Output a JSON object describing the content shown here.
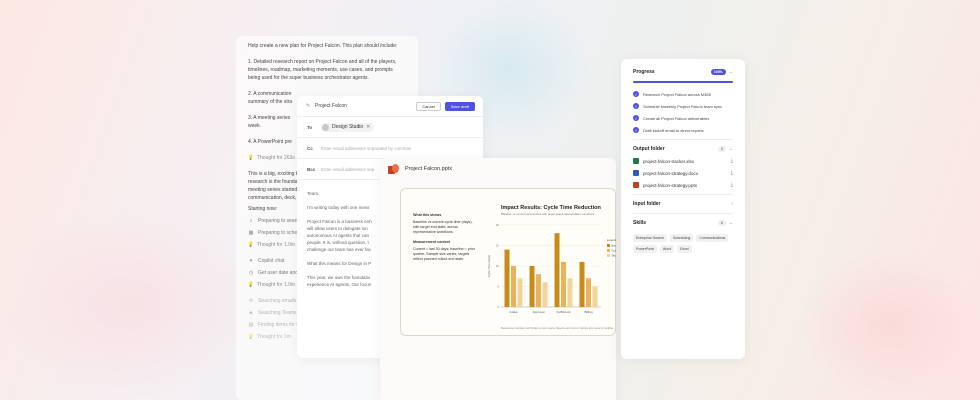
{
  "chat": {
    "prompt_intro": "Help create a new plan for Project Falcon. This plan should include:",
    "item1": "1. Detailed research report on Project Falcon and all of the players, timelines, roadmap, marketing moments, use cases, and prompts being used for the super business orchestrator agents.",
    "item2": "2. A communication",
    "item2b": "summary of the stra",
    "item3": "3. A meeting series",
    "item3b": "week.",
    "item4": "4. A PowerPoint pre",
    "thought1": "Thought for 263s",
    "body1": "This is a big, exciting kic",
    "body2": "research is the foundatio",
    "body3": "meeting series started. C",
    "body4": "communication, deck, st",
    "starting": "Starting now:",
    "step1": "Preparing to search acro",
    "step2": "Preparing to schedule w",
    "thought2": "Thought for 1.0m",
    "copilot": "Copilot chat",
    "step3": "Get user date and time",
    "thought3": "Thought for 1.0m",
    "step4": "Searching emails for \"Pr",
    "step5": "Searching Teams for \"Pr",
    "step6": "Finding items for Pr",
    "thought4": "Thought for 1m"
  },
  "email": {
    "title": "Project Falcon",
    "cancel": "Cancel",
    "send": "Save draft",
    "to_label": "To",
    "to_chip": "Design Studio",
    "cc_label": "Cc",
    "cc_placeholder": "Enter email addresses separated by commas",
    "bcc_label": "Bcc",
    "bcc_placeholder": "Enter email addresses sep",
    "greeting": "Team,",
    "p1": "I'm writing today with one mess",
    "p2a": "Project Falcon is a business enh",
    "p2b": "will allow users to delegate lon",
    "p2c": "autonomous AI agents that can",
    "p2d": "people. It is, without question, t",
    "p2e": "challenge our team has ever fac",
    "p3": "What this means for Design in P",
    "p4a": "This year, we own the foundatio",
    "p4b": "experience AI agents. Our focus"
  },
  "viewer": {
    "filename": "Project Falcon.pptx"
  },
  "slide": {
    "what_heading": "What this shows",
    "what_text": "Baseline vs current cycle time (days), with target end state, across representative workflows.",
    "measure_heading": "Measurement context",
    "measure_text": "Current = last 30 days; baseline = prior quarter. Sample size varies; targets reflect planned rollout end state.",
    "footnote": "Measurement window: last 30 days vs prior quarter. Baseline and Current. Sample size varies by workflow."
  },
  "chart_data": {
    "type": "bar",
    "title": "Impact Results: Cycle Time Reduction",
    "subtitle": "Baseline vs current performance with target post-implementation conditions",
    "ylabel": "Cycle Time (days)",
    "xlabel": "",
    "categories": [
      "Intake",
      "Approval",
      "Fulfillment",
      "Billing"
    ],
    "series": [
      {
        "name": "Baseline",
        "values": [
          14,
          10,
          18,
          11
        ]
      },
      {
        "name": "Current",
        "values": [
          10,
          8,
          11,
          7
        ]
      },
      {
        "name": "Target",
        "values": [
          7,
          6,
          7,
          5
        ]
      }
    ],
    "legend_title": "Legend",
    "legend_position": "right",
    "colors": [
      "#c98a18",
      "#e8b35a",
      "#f3d49a"
    ],
    "ylim": [
      0,
      20
    ],
    "yticks": [
      0,
      5,
      10,
      15,
      20
    ],
    "grid": true
  },
  "progress": {
    "title": "Progress",
    "percent": "100%",
    "fraction": 1.0,
    "tasks": [
      "Research Project Falcon across M365",
      "Schedule biweekly Project Falcon team sync",
      "Create all Project Falcon deliverables",
      "Draft kickoff email to direct reports"
    ],
    "output_title": "Output folder",
    "output_count": "3",
    "files": [
      {
        "name": "project-falcon-tracker.xlsx",
        "color": "#1d7a45"
      },
      {
        "name": "project-falcon-strategy.docx",
        "color": "#2b5fbe"
      },
      {
        "name": "project-falcon-strategy.pptx",
        "color": "#c43e1c"
      }
    ],
    "input_title": "Input folder",
    "skills_title": "Skills",
    "skills_count": "6",
    "skills": [
      "Enterprise Search",
      "Scheduling",
      "Communications",
      "PowerPoint",
      "Word",
      "Excel"
    ]
  }
}
